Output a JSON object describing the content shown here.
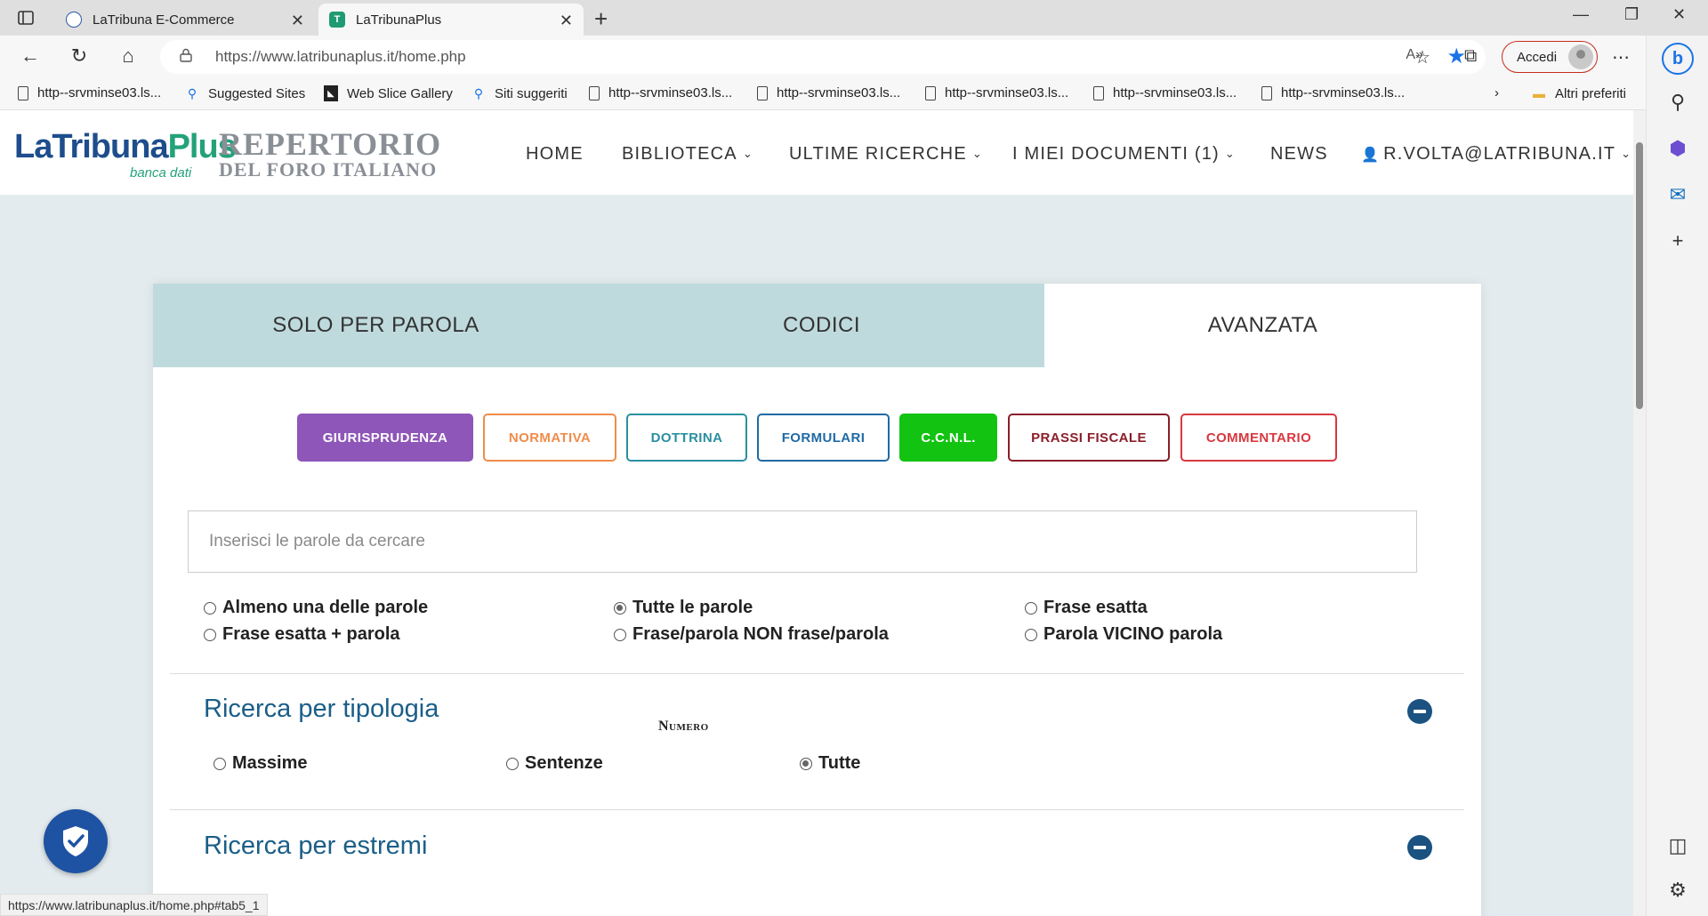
{
  "browser": {
    "tabs": [
      {
        "title": "LaTribuna E-Commerce",
        "active": false
      },
      {
        "title": "LaTribunaPlus",
        "active": true
      }
    ],
    "url": "https://www.latribunaplus.it/home.php",
    "signin_label": "Accedi",
    "bookmarks": [
      {
        "label": "http--srvminse03.ls...",
        "icon": "doc-icon"
      },
      {
        "label": "Suggested Sites",
        "icon": "search-icon"
      },
      {
        "label": "Web Slice Gallery",
        "icon": "slice-icon"
      },
      {
        "label": "Siti suggeriti",
        "icon": "search-icon"
      },
      {
        "label": "http--srvminse03.ls...",
        "icon": "doc-icon"
      },
      {
        "label": "http--srvminse03.ls...",
        "icon": "doc-icon"
      },
      {
        "label": "http--srvminse03.ls...",
        "icon": "doc-icon"
      },
      {
        "label": "http--srvminse03.ls...",
        "icon": "doc-icon"
      },
      {
        "label": "http--srvminse03.ls...",
        "icon": "doc-icon"
      }
    ],
    "other_favorites": "Altri preferiti",
    "status_url": "https://www.latribunaplus.it/home.php#tab5_1"
  },
  "site": {
    "logo": {
      "part1": "LaTribuna",
      "part2": "Plus",
      "sub": "banca dati"
    },
    "logo2": {
      "line1": "REPERTORIO",
      "line2": "DEL FORO ITALIANO"
    },
    "nav": {
      "home": "HOME",
      "biblioteca": "BIBLIOTECA",
      "ultime": "ULTIME RICERCHE",
      "documenti": "I MIEI DOCUMENTI (1)",
      "news": "NEWS",
      "user": "R.VOLTA@LATRIBUNA.IT"
    }
  },
  "search": {
    "tabs": [
      "SOLO PER PAROLA",
      "CODICI",
      "AVANZATA"
    ],
    "active_tab": "AVANZATA",
    "categories": [
      {
        "label": "GIURISPRUDENZA",
        "color": "#8e56b8",
        "filled": true
      },
      {
        "label": "NORMATIVA",
        "color": "#f08c4a",
        "filled": false
      },
      {
        "label": "DOTTRINA",
        "color": "#2a8fa0",
        "filled": false
      },
      {
        "label": "FORMULARI",
        "color": "#1f6aa5",
        "filled": false
      },
      {
        "label": "C.C.N.L.",
        "color": "#12c312",
        "filled": true
      },
      {
        "label": "PRASSI FISCALE",
        "color": "#8b1e2a",
        "filled": false
      },
      {
        "label": "COMMENTARIO",
        "color": "#d9383f",
        "filled": false
      }
    ],
    "placeholder": "Inserisci le parole da cercare",
    "value": "",
    "modes": [
      {
        "label": "Almeno una delle parole",
        "checked": false
      },
      {
        "label": "Tutte le parole",
        "checked": true
      },
      {
        "label": "Frase esatta",
        "checked": false
      },
      {
        "label": "Frase esatta + parola",
        "checked": false
      },
      {
        "label": "Frase/parola NON frase/parola",
        "checked": false
      },
      {
        "label": "Parola VICINO parola",
        "checked": false
      }
    ],
    "tipologia": {
      "title": "Ricerca per tipologia",
      "options": [
        {
          "label": "Massime",
          "checked": false
        },
        {
          "label": "Sentenze",
          "checked": false
        },
        {
          "label": "Tutte",
          "checked": true
        }
      ]
    },
    "estremi": {
      "title": "Ricerca per estremi",
      "numero_label": "Numero"
    }
  }
}
